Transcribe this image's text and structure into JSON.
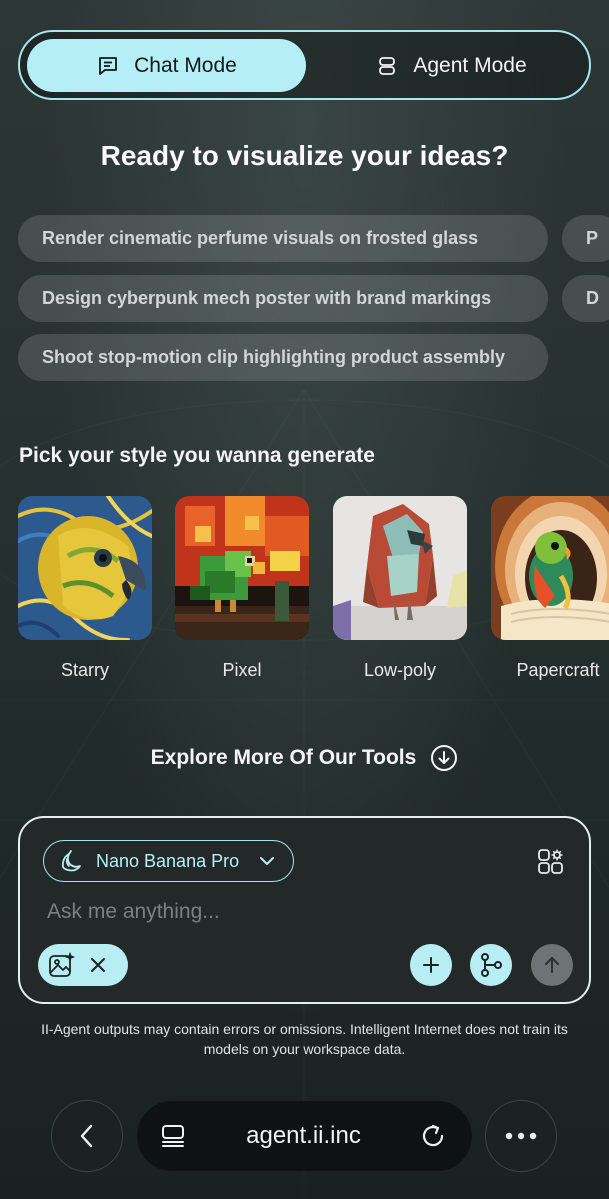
{
  "mode_toggle": {
    "chat_label": "Chat Mode",
    "agent_label": "Agent Mode",
    "active": "chat"
  },
  "headline": "Ready to visualize your ideas?",
  "suggestions": [
    "Render cinematic perfume visuals on frosted glass",
    "Design cyberpunk mech poster with brand markings",
    "Shoot stop-motion clip highlighting product assembly",
    "P",
    "D"
  ],
  "styles_section": {
    "title": "Pick your style you wanna generate",
    "items": [
      {
        "label": "Starry",
        "image": "parrot-starry-night-image"
      },
      {
        "label": "Pixel",
        "image": "parrot-pixel-art-image"
      },
      {
        "label": "Low-poly",
        "image": "parrot-low-poly-image"
      },
      {
        "label": "Papercraft",
        "image": "parrot-papercraft-image"
      }
    ]
  },
  "explore_label": "Explore More Of Our Tools",
  "composer": {
    "model_label": "Nano Banana Pro",
    "placeholder": "Ask me anything...",
    "icons": [
      "banana-icon",
      "chevron-down-icon",
      "apps-settings-icon",
      "image-sparkle-icon",
      "close-icon",
      "plus-icon",
      "branch-icon",
      "arrow-up-icon"
    ]
  },
  "disclaimer": "II-Agent outputs may contain errors or omissions. Intelligent Internet does not train its models on your workspace data.",
  "browser": {
    "url": "agent.ii.inc"
  },
  "colors": {
    "accent": "#b6eef5",
    "background": "#263130",
    "chip": "#3e4747"
  }
}
